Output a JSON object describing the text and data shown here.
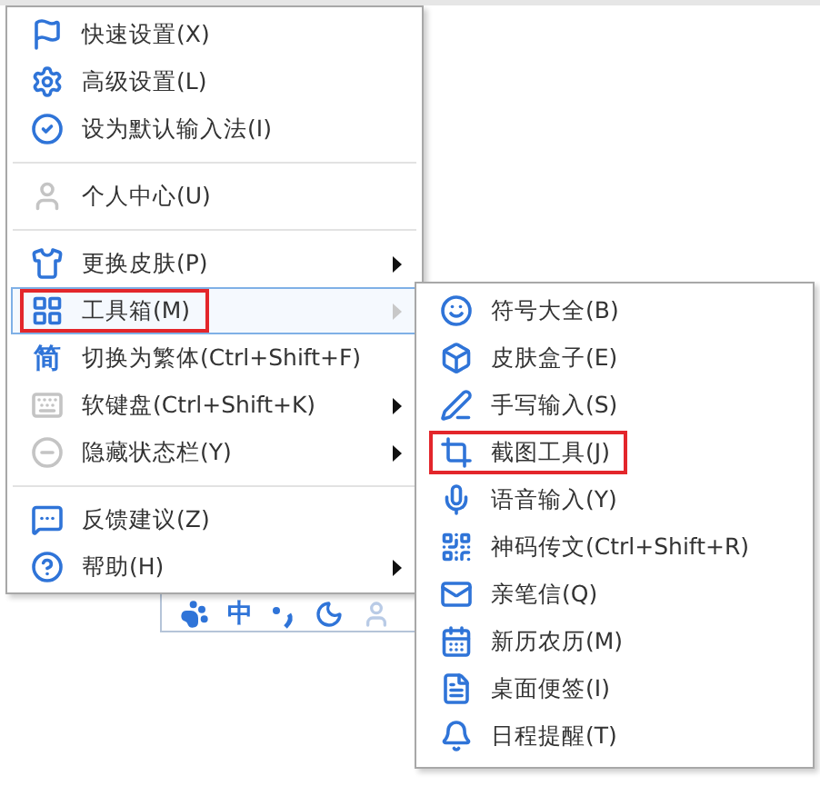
{
  "status_bar": {
    "input_mode": "中"
  },
  "menu": {
    "groups": [
      [
        {
          "label": "快速设置(X)",
          "submenu": false,
          "selected": false,
          "marked": false
        },
        {
          "label": "高级设置(L)",
          "submenu": false,
          "selected": false,
          "marked": false
        },
        {
          "label": "设为默认输入法(I)",
          "submenu": false,
          "selected": false,
          "marked": false
        }
      ],
      [
        {
          "label": "个人中心(U)",
          "submenu": false,
          "selected": false,
          "marked": false
        }
      ],
      [
        {
          "label": "更换皮肤(P)",
          "submenu": true,
          "selected": false,
          "marked": false
        },
        {
          "label": "工具箱(M)",
          "submenu": true,
          "selected": true,
          "marked": true
        },
        {
          "label": "切换为繁体(Ctrl+Shift+F)",
          "glyph": "简",
          "submenu": false,
          "selected": false,
          "marked": false
        },
        {
          "label": "软键盘(Ctrl+Shift+K)",
          "submenu": true,
          "selected": false,
          "marked": false
        },
        {
          "label": "隐藏状态栏(Y)",
          "submenu": true,
          "selected": false,
          "marked": false
        }
      ],
      [
        {
          "label": "反馈建议(Z)",
          "submenu": false,
          "selected": false,
          "marked": false
        },
        {
          "label": "帮助(H)",
          "submenu": true,
          "selected": false,
          "marked": false
        }
      ]
    ]
  },
  "submenu": {
    "items": [
      {
        "label": "符号大全(B)",
        "marked": false
      },
      {
        "label": "皮肤盒子(E)",
        "marked": false
      },
      {
        "label": "手写输入(S)",
        "marked": false
      },
      {
        "label": "截图工具(J)",
        "marked": true
      },
      {
        "label": "语音输入(Y)",
        "marked": false
      },
      {
        "label": "神码传文(Ctrl+Shift+R)",
        "marked": false
      },
      {
        "label": "亲笔信(Q)",
        "marked": false
      },
      {
        "label": "新历农历(M)",
        "marked": false
      },
      {
        "label": "桌面便签(I)",
        "marked": false
      },
      {
        "label": "日程提醒(T)",
        "marked": false
      }
    ]
  }
}
